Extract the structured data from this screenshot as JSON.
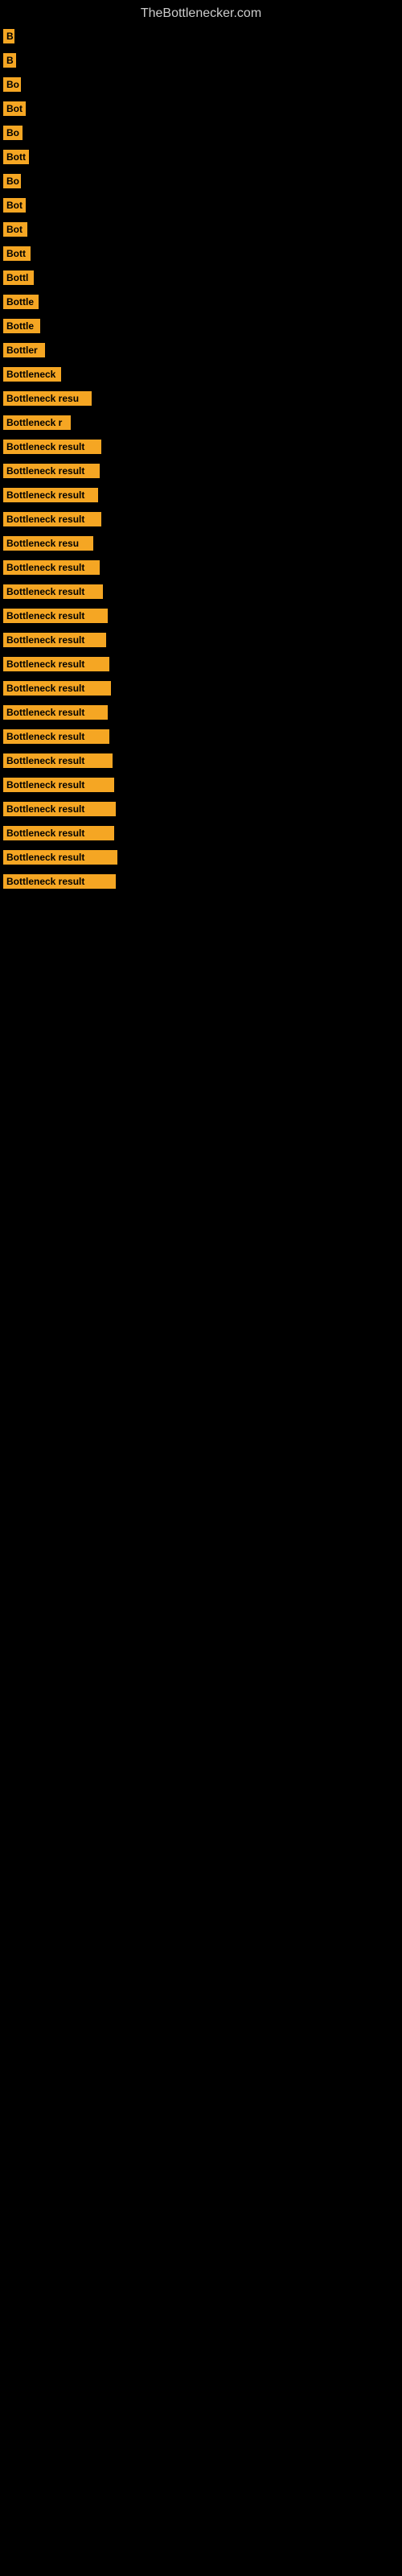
{
  "site": {
    "title": "TheBottlenecker.com"
  },
  "bars": [
    {
      "label": "B",
      "width": 14
    },
    {
      "label": "B",
      "width": 16
    },
    {
      "label": "Bo",
      "width": 22
    },
    {
      "label": "Bot",
      "width": 28
    },
    {
      "label": "Bo",
      "width": 24
    },
    {
      "label": "Bott",
      "width": 32
    },
    {
      "label": "Bo",
      "width": 22
    },
    {
      "label": "Bot",
      "width": 28
    },
    {
      "label": "Bot",
      "width": 30
    },
    {
      "label": "Bott",
      "width": 34
    },
    {
      "label": "Bottl",
      "width": 38
    },
    {
      "label": "Bottle",
      "width": 44
    },
    {
      "label": "Bottle",
      "width": 46
    },
    {
      "label": "Bottler",
      "width": 52
    },
    {
      "label": "Bottleneck",
      "width": 72
    },
    {
      "label": "Bottleneck resu",
      "width": 110
    },
    {
      "label": "Bottleneck r",
      "width": 84
    },
    {
      "label": "Bottleneck result",
      "width": 122
    },
    {
      "label": "Bottleneck result",
      "width": 120
    },
    {
      "label": "Bottleneck result",
      "width": 118
    },
    {
      "label": "Bottleneck result",
      "width": 122
    },
    {
      "label": "Bottleneck resu",
      "width": 112
    },
    {
      "label": "Bottleneck result",
      "width": 120
    },
    {
      "label": "Bottleneck result",
      "width": 124
    },
    {
      "label": "Bottleneck result",
      "width": 130
    },
    {
      "label": "Bottleneck result",
      "width": 128
    },
    {
      "label": "Bottleneck result",
      "width": 132
    },
    {
      "label": "Bottleneck result",
      "width": 134
    },
    {
      "label": "Bottleneck result",
      "width": 130
    },
    {
      "label": "Bottleneck result",
      "width": 132
    },
    {
      "label": "Bottleneck result",
      "width": 136
    },
    {
      "label": "Bottleneck result",
      "width": 138
    },
    {
      "label": "Bottleneck result",
      "width": 140
    },
    {
      "label": "Bottleneck result",
      "width": 138
    },
    {
      "label": "Bottleneck result",
      "width": 142
    },
    {
      "label": "Bottleneck result",
      "width": 140
    }
  ]
}
